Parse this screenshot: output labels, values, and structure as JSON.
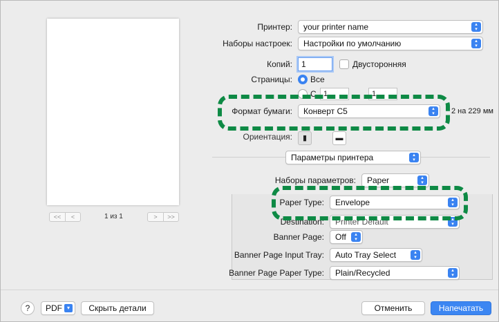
{
  "preview": {
    "page_indicator": "1 из 1",
    "nav_left": [
      "<<",
      "<"
    ],
    "nav_right": [
      ">",
      ">>"
    ]
  },
  "printer": {
    "label": "Принтер:",
    "value": "your printer name"
  },
  "presets": {
    "label": "Наборы настроек:",
    "value": "Настройки по умолчанию"
  },
  "copies": {
    "label": "Копий:",
    "value": "1",
    "duplex_label": "Двусторонняя"
  },
  "pages": {
    "label": "Страницы:",
    "all_label": "Все",
    "from_label": "С",
    "from_value": "1",
    "to_value": "1"
  },
  "paper": {
    "label": "Формат бумаги:",
    "value": "Конверт C5",
    "size_text": "2 на 229 мм"
  },
  "orientation": {
    "label": "Ориентация:",
    "portrait_glyph": "▮",
    "landscape_glyph": "▬"
  },
  "panel_menu": {
    "value": "Параметры принтера"
  },
  "feature_sets": {
    "label": "Наборы параметров:",
    "value": "Paper"
  },
  "paper_type": {
    "label": "Paper Type:",
    "value": "Envelope"
  },
  "destination": {
    "label": "Destination:",
    "value": "Printer Default"
  },
  "banner_page": {
    "label": "Banner Page:",
    "value": "Off"
  },
  "banner_tray": {
    "label": "Banner Page Input Tray:",
    "value": "Auto Tray Select"
  },
  "banner_paper_type": {
    "label": "Banner Page Paper Type:",
    "value": "Plain/Recycled"
  },
  "footer": {
    "help": "?",
    "pdf": "PDF",
    "hide_details": "Скрыть детали",
    "cancel": "Отменить",
    "print": "Напечатать"
  },
  "colors": {
    "accent": "#3c86f2",
    "highlight": "#0e8a45",
    "background": "#ececec"
  }
}
